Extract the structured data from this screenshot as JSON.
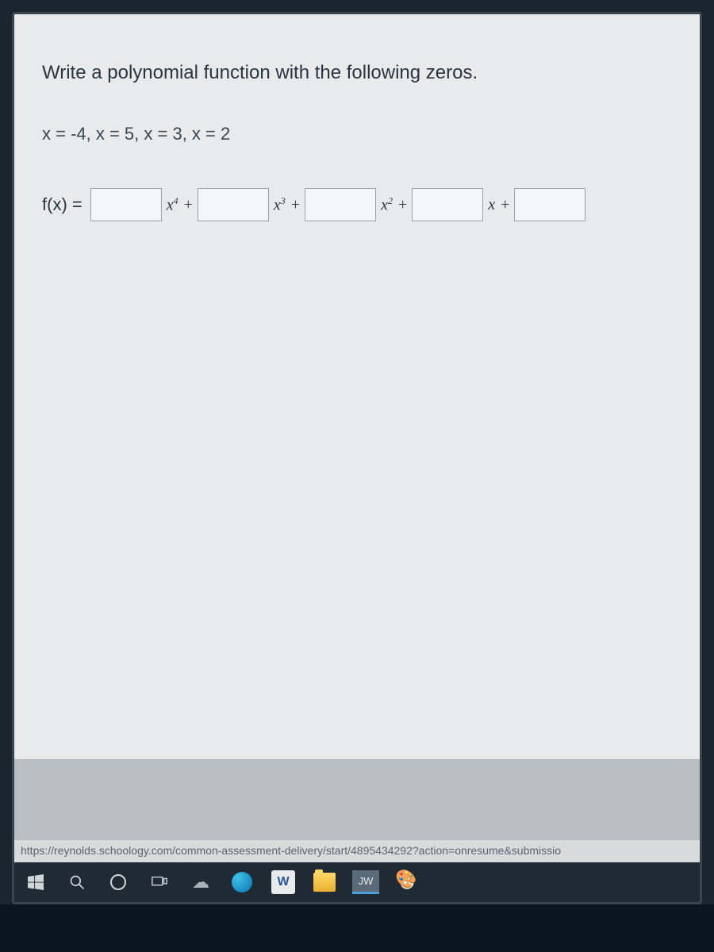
{
  "question": {
    "title": "Write a polynomial function with the following zeros.",
    "zeros": "x = -4, x = 5, x = 3, x = 2",
    "function_label": "f(x) =",
    "terms": {
      "x4": "x",
      "x4_sup": "4",
      "x3": "x",
      "x3_sup": "3",
      "x2": "x",
      "x2_sup": "2",
      "x1": "x",
      "plus": " +"
    },
    "inputs": {
      "c4": "",
      "c3": "",
      "c2": "",
      "c1": "",
      "c0": ""
    }
  },
  "url": "https://reynolds.schoology.com/common-assessment-delivery/start/4895434292?action=onresume&submissio",
  "taskbar": {
    "word_label": "W",
    "jw_label": "JW"
  }
}
